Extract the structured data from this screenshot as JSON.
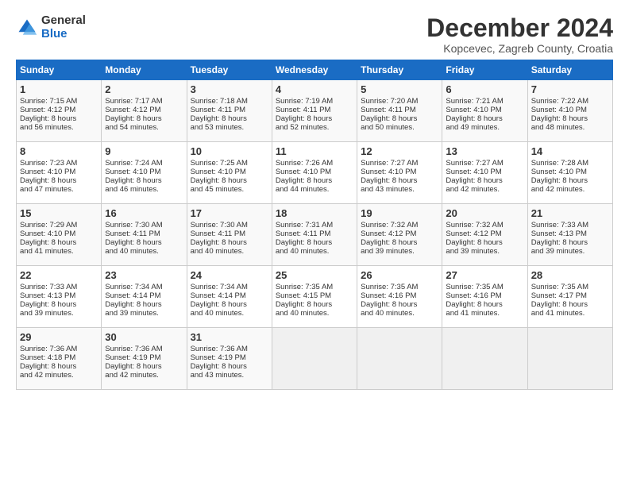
{
  "header": {
    "logo_general": "General",
    "logo_blue": "Blue",
    "month_title": "December 2024",
    "location": "Kopcevec, Zagreb County, Croatia"
  },
  "days_of_week": [
    "Sunday",
    "Monday",
    "Tuesday",
    "Wednesday",
    "Thursday",
    "Friday",
    "Saturday"
  ],
  "weeks": [
    [
      {
        "day": "1",
        "lines": [
          "Sunrise: 7:15 AM",
          "Sunset: 4:12 PM",
          "Daylight: 8 hours",
          "and 56 minutes."
        ]
      },
      {
        "day": "2",
        "lines": [
          "Sunrise: 7:17 AM",
          "Sunset: 4:12 PM",
          "Daylight: 8 hours",
          "and 54 minutes."
        ]
      },
      {
        "day": "3",
        "lines": [
          "Sunrise: 7:18 AM",
          "Sunset: 4:11 PM",
          "Daylight: 8 hours",
          "and 53 minutes."
        ]
      },
      {
        "day": "4",
        "lines": [
          "Sunrise: 7:19 AM",
          "Sunset: 4:11 PM",
          "Daylight: 8 hours",
          "and 52 minutes."
        ]
      },
      {
        "day": "5",
        "lines": [
          "Sunrise: 7:20 AM",
          "Sunset: 4:11 PM",
          "Daylight: 8 hours",
          "and 50 minutes."
        ]
      },
      {
        "day": "6",
        "lines": [
          "Sunrise: 7:21 AM",
          "Sunset: 4:10 PM",
          "Daylight: 8 hours",
          "and 49 minutes."
        ]
      },
      {
        "day": "7",
        "lines": [
          "Sunrise: 7:22 AM",
          "Sunset: 4:10 PM",
          "Daylight: 8 hours",
          "and 48 minutes."
        ]
      }
    ],
    [
      {
        "day": "8",
        "lines": [
          "Sunrise: 7:23 AM",
          "Sunset: 4:10 PM",
          "Daylight: 8 hours",
          "and 47 minutes."
        ]
      },
      {
        "day": "9",
        "lines": [
          "Sunrise: 7:24 AM",
          "Sunset: 4:10 PM",
          "Daylight: 8 hours",
          "and 46 minutes."
        ]
      },
      {
        "day": "10",
        "lines": [
          "Sunrise: 7:25 AM",
          "Sunset: 4:10 PM",
          "Daylight: 8 hours",
          "and 45 minutes."
        ]
      },
      {
        "day": "11",
        "lines": [
          "Sunrise: 7:26 AM",
          "Sunset: 4:10 PM",
          "Daylight: 8 hours",
          "and 44 minutes."
        ]
      },
      {
        "day": "12",
        "lines": [
          "Sunrise: 7:27 AM",
          "Sunset: 4:10 PM",
          "Daylight: 8 hours",
          "and 43 minutes."
        ]
      },
      {
        "day": "13",
        "lines": [
          "Sunrise: 7:27 AM",
          "Sunset: 4:10 PM",
          "Daylight: 8 hours",
          "and 42 minutes."
        ]
      },
      {
        "day": "14",
        "lines": [
          "Sunrise: 7:28 AM",
          "Sunset: 4:10 PM",
          "Daylight: 8 hours",
          "and 42 minutes."
        ]
      }
    ],
    [
      {
        "day": "15",
        "lines": [
          "Sunrise: 7:29 AM",
          "Sunset: 4:10 PM",
          "Daylight: 8 hours",
          "and 41 minutes."
        ]
      },
      {
        "day": "16",
        "lines": [
          "Sunrise: 7:30 AM",
          "Sunset: 4:11 PM",
          "Daylight: 8 hours",
          "and 40 minutes."
        ]
      },
      {
        "day": "17",
        "lines": [
          "Sunrise: 7:30 AM",
          "Sunset: 4:11 PM",
          "Daylight: 8 hours",
          "and 40 minutes."
        ]
      },
      {
        "day": "18",
        "lines": [
          "Sunrise: 7:31 AM",
          "Sunset: 4:11 PM",
          "Daylight: 8 hours",
          "and 40 minutes."
        ]
      },
      {
        "day": "19",
        "lines": [
          "Sunrise: 7:32 AM",
          "Sunset: 4:12 PM",
          "Daylight: 8 hours",
          "and 39 minutes."
        ]
      },
      {
        "day": "20",
        "lines": [
          "Sunrise: 7:32 AM",
          "Sunset: 4:12 PM",
          "Daylight: 8 hours",
          "and 39 minutes."
        ]
      },
      {
        "day": "21",
        "lines": [
          "Sunrise: 7:33 AM",
          "Sunset: 4:13 PM",
          "Daylight: 8 hours",
          "and 39 minutes."
        ]
      }
    ],
    [
      {
        "day": "22",
        "lines": [
          "Sunrise: 7:33 AM",
          "Sunset: 4:13 PM",
          "Daylight: 8 hours",
          "and 39 minutes."
        ]
      },
      {
        "day": "23",
        "lines": [
          "Sunrise: 7:34 AM",
          "Sunset: 4:14 PM",
          "Daylight: 8 hours",
          "and 39 minutes."
        ]
      },
      {
        "day": "24",
        "lines": [
          "Sunrise: 7:34 AM",
          "Sunset: 4:14 PM",
          "Daylight: 8 hours",
          "and 40 minutes."
        ]
      },
      {
        "day": "25",
        "lines": [
          "Sunrise: 7:35 AM",
          "Sunset: 4:15 PM",
          "Daylight: 8 hours",
          "and 40 minutes."
        ]
      },
      {
        "day": "26",
        "lines": [
          "Sunrise: 7:35 AM",
          "Sunset: 4:16 PM",
          "Daylight: 8 hours",
          "and 40 minutes."
        ]
      },
      {
        "day": "27",
        "lines": [
          "Sunrise: 7:35 AM",
          "Sunset: 4:16 PM",
          "Daylight: 8 hours",
          "and 41 minutes."
        ]
      },
      {
        "day": "28",
        "lines": [
          "Sunrise: 7:35 AM",
          "Sunset: 4:17 PM",
          "Daylight: 8 hours",
          "and 41 minutes."
        ]
      }
    ],
    [
      {
        "day": "29",
        "lines": [
          "Sunrise: 7:36 AM",
          "Sunset: 4:18 PM",
          "Daylight: 8 hours",
          "and 42 minutes."
        ]
      },
      {
        "day": "30",
        "lines": [
          "Sunrise: 7:36 AM",
          "Sunset: 4:19 PM",
          "Daylight: 8 hours",
          "and 42 minutes."
        ]
      },
      {
        "day": "31",
        "lines": [
          "Sunrise: 7:36 AM",
          "Sunset: 4:19 PM",
          "Daylight: 8 hours",
          "and 43 minutes."
        ]
      },
      null,
      null,
      null,
      null
    ]
  ]
}
